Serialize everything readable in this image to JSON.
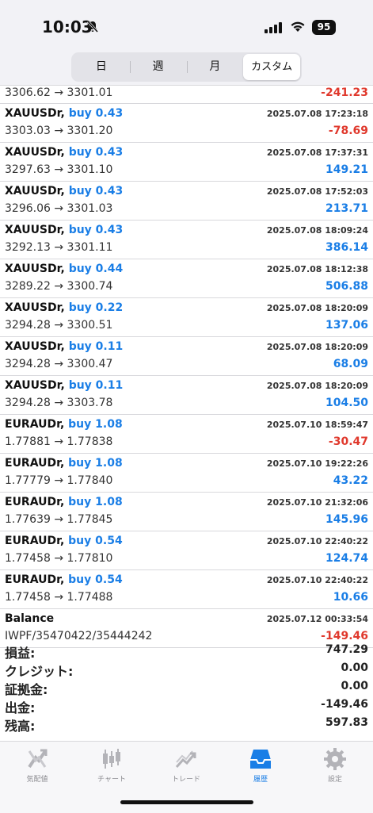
{
  "status": {
    "time": "10:03",
    "battery": "95"
  },
  "segments": [
    {
      "label": "日",
      "active": false
    },
    {
      "label": "週",
      "active": false
    },
    {
      "label": "月",
      "active": false
    },
    {
      "label": "カスタム",
      "active": true
    }
  ],
  "first_row": {
    "prices": "3306.62 → 3301.01",
    "profit": "-241.23"
  },
  "trades": [
    {
      "symbol": "XAUUSDr,",
      "side": "buy 0.43",
      "date": "2025.07.08 17:23:18",
      "prices": "3303.03 → 3301.20",
      "profit": "-78.69"
    },
    {
      "symbol": "XAUUSDr,",
      "side": "buy 0.43",
      "date": "2025.07.08 17:37:31",
      "prices": "3297.63 → 3301.10",
      "profit": "149.21"
    },
    {
      "symbol": "XAUUSDr,",
      "side": "buy 0.43",
      "date": "2025.07.08 17:52:03",
      "prices": "3296.06 → 3301.03",
      "profit": "213.71"
    },
    {
      "symbol": "XAUUSDr,",
      "side": "buy 0.43",
      "date": "2025.07.08 18:09:24",
      "prices": "3292.13 → 3301.11",
      "profit": "386.14"
    },
    {
      "symbol": "XAUUSDr,",
      "side": "buy 0.44",
      "date": "2025.07.08 18:12:38",
      "prices": "3289.22 → 3300.74",
      "profit": "506.88"
    },
    {
      "symbol": "XAUUSDr,",
      "side": "buy 0.22",
      "date": "2025.07.08 18:20:09",
      "prices": "3294.28 → 3300.51",
      "profit": "137.06"
    },
    {
      "symbol": "XAUUSDr,",
      "side": "buy 0.11",
      "date": "2025.07.08 18:20:09",
      "prices": "3294.28 → 3300.47",
      "profit": "68.09"
    },
    {
      "symbol": "XAUUSDr,",
      "side": "buy 0.11",
      "date": "2025.07.08 18:20:09",
      "prices": "3294.28 → 3303.78",
      "profit": "104.50"
    },
    {
      "symbol": "EURAUDr,",
      "side": "buy 1.08",
      "date": "2025.07.10 18:59:47",
      "prices": "1.77881 → 1.77838",
      "profit": "-30.47"
    },
    {
      "symbol": "EURAUDr,",
      "side": "buy 1.08",
      "date": "2025.07.10 19:22:26",
      "prices": "1.77779 → 1.77840",
      "profit": "43.22"
    },
    {
      "symbol": "EURAUDr,",
      "side": "buy 1.08",
      "date": "2025.07.10 21:32:06",
      "prices": "1.77639 → 1.77845",
      "profit": "145.96"
    },
    {
      "symbol": "EURAUDr,",
      "side": "buy 0.54",
      "date": "2025.07.10 22:40:22",
      "prices": "1.77458 → 1.77810",
      "profit": "124.74"
    },
    {
      "symbol": "EURAUDr,",
      "side": "buy 0.54",
      "date": "2025.07.10 22:40:22",
      "prices": "1.77458 → 1.77488",
      "profit": "10.66"
    },
    {
      "symbol": "Balance",
      "side": "",
      "date": "2025.07.12 00:33:54",
      "prices": "IWPF/35470422/35444242",
      "profit": "-149.46"
    }
  ],
  "summary": [
    {
      "label": "損益:",
      "value": "747.29"
    },
    {
      "label": "クレジット:",
      "value": "0.00"
    },
    {
      "label": "証拠金:",
      "value": "0.00"
    },
    {
      "label": "出金:",
      "value": "-149.46"
    },
    {
      "label": "残高:",
      "value": "597.83"
    }
  ],
  "tabs": [
    {
      "label": "気配値",
      "icon": "quotes-icon",
      "active": false
    },
    {
      "label": "チャート",
      "icon": "chart-icon",
      "active": false
    },
    {
      "label": "トレード",
      "icon": "trade-icon",
      "active": false
    },
    {
      "label": "履歴",
      "icon": "history-icon",
      "active": true
    },
    {
      "label": "設定",
      "icon": "settings-icon",
      "active": false
    }
  ],
  "colors": {
    "positive": "#1a7ee6",
    "negative": "#e0392d",
    "active_tab": "#1a7ee6",
    "inactive_tab": "#b3b3b8"
  }
}
